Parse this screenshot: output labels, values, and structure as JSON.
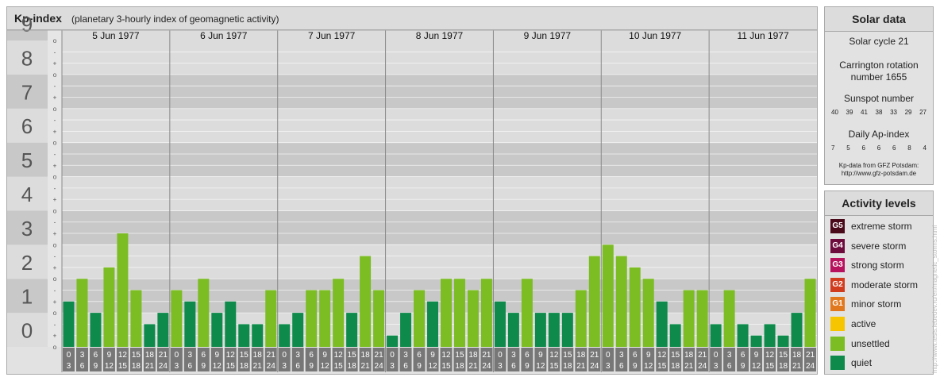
{
  "header": {
    "title": "Kp-index",
    "subtitle": "(planetary 3-hourly index of geomagnetic activity)"
  },
  "chart_data": {
    "type": "bar",
    "title": "Kp-index",
    "subtitle": "(planetary 3-hourly index of geomagnetic activity)",
    "ylim": [
      0,
      9
    ],
    "y_ticks": [
      "0",
      "1",
      "2",
      "3",
      "4",
      "5",
      "6",
      "7",
      "8",
      "9"
    ],
    "minor_tick_marks": [
      "-",
      "o",
      "+"
    ],
    "days": [
      "5 Jun 1977",
      "6 Jun 1977",
      "7 Jun 1977",
      "8 Jun 1977",
      "9 Jun 1977",
      "10 Jun 1977",
      "11 Jun 1977"
    ],
    "interval_start": [
      "0",
      "3",
      "6",
      "9",
      "12",
      "15",
      "18",
      "21"
    ],
    "interval_end": [
      "3",
      "6",
      "9",
      "12",
      "15",
      "18",
      "21",
      "24"
    ],
    "series": [
      {
        "values": [
          1.333,
          2.0,
          1.0,
          2.333,
          3.333,
          1.667,
          0.667,
          1.0,
          1.667,
          1.333,
          2.0,
          1.0,
          1.333,
          0.667,
          0.667,
          1.667,
          0.667,
          1.0,
          1.667,
          1.667,
          2.0,
          1.0,
          2.667,
          1.667,
          0.333,
          1.0,
          1.667,
          1.333,
          2.0,
          2.0,
          1.667,
          2.0,
          1.333,
          1.0,
          2.0,
          1.0,
          1.0,
          1.0,
          1.667,
          2.667,
          3.0,
          2.667,
          2.333,
          2.0,
          1.333,
          0.667,
          1.667,
          1.667,
          0.667,
          1.667,
          0.667,
          0.333,
          0.667,
          0.333,
          1.0,
          2.0
        ]
      }
    ],
    "colors": {
      "quiet": "#0e8a4b",
      "unsettled": "#7bbd22"
    },
    "grid": true
  },
  "solar": {
    "title": "Solar data",
    "cycle": "Solar cycle 21",
    "carrington_line1": "Carrington rotation",
    "carrington_line2": "number 1655",
    "sunspot_label": "Sunspot number",
    "sunspot_values": [
      "40",
      "39",
      "41",
      "38",
      "33",
      "29",
      "27"
    ],
    "ap_label": "Daily Ap-index",
    "ap_values": [
      "7",
      "5",
      "6",
      "6",
      "6",
      "8",
      "4"
    ],
    "source_line1": "Kp-data from GFZ Potsdam:",
    "source_line2": "http://www.gfz-potsdam.de"
  },
  "activity": {
    "title": "Activity levels",
    "levels": [
      {
        "code": "G5",
        "label": "extreme storm",
        "color": "#4a0a1a"
      },
      {
        "code": "G4",
        "label": "severe storm",
        "color": "#6e0c3e"
      },
      {
        "code": "G3",
        "label": "strong storm",
        "color": "#b8115d"
      },
      {
        "code": "G2",
        "label": "moderate storm",
        "color": "#d23c1e"
      },
      {
        "code": "G1",
        "label": "minor storm",
        "color": "#e2781d"
      },
      {
        "code": "",
        "label": "active",
        "color": "#f7c500"
      },
      {
        "code": "",
        "label": "unsettled",
        "color": "#7bbd22"
      },
      {
        "code": "",
        "label": "quiet",
        "color": "#0e8a4b"
      }
    ]
  },
  "watermark": "http://www.tesis.lebedev.ru/en/magnetic_storms.html"
}
